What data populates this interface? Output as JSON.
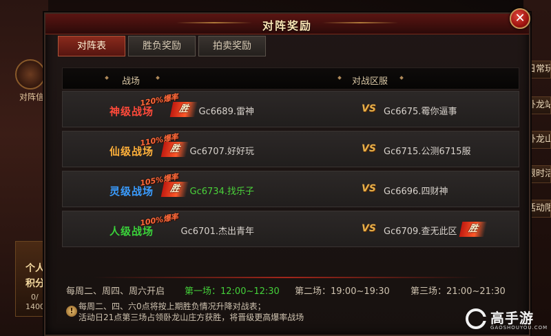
{
  "background": {
    "left_label": "对阵信",
    "personal_1": "个人",
    "personal_2": "积分",
    "personal_3": "0/",
    "personal_4": "1400",
    "right_tabs": [
      "日常玩",
      "卧龙站",
      "卧龙山",
      "限时活",
      "活动限"
    ]
  },
  "dialog": {
    "title": "对阵奖励",
    "close_symbol": "✕"
  },
  "tabs": [
    "对阵表",
    "胜负奖励",
    "拍卖奖励"
  ],
  "table": {
    "headers": {
      "battlefield": "战场",
      "servers": "对战区服"
    },
    "vs_label": "VS",
    "win_label": "胜",
    "rows": [
      {
        "level": "神级战场",
        "rate": "120%爆率",
        "level_color": "#ff4a3a",
        "team_a": "Gc6689.雷神",
        "team_a_color": "#d8d2cc",
        "team_b": "Gc6675.霉你逼事",
        "winner": "a"
      },
      {
        "level": "仙级战场",
        "rate": "110%爆率",
        "level_color": "#ffb03a",
        "team_a": "Gc6707.好好玩",
        "team_a_color": "#d8d2cc",
        "team_b": "Gc6715.公测6715服",
        "winner": "a"
      },
      {
        "level": "灵级战场",
        "rate": "105%爆率",
        "level_color": "#3a9cff",
        "team_a": "Gc6734.找乐子",
        "team_a_color": "#4ad13a",
        "team_b": "Gc6696.四财神",
        "winner": "a"
      },
      {
        "level": "人级战场",
        "rate": "100%爆率",
        "level_color": "#3ad13a",
        "team_a": "Gc6701.杰出青年",
        "team_a_color": "#d8d2cc",
        "team_b": "Gc6709.查无此区",
        "winner": "b"
      }
    ]
  },
  "schedule": {
    "days": "每周二、周四、周六开启",
    "round1": "第一场：12:00~12:30",
    "round2": "第二场：19:00~19:30",
    "round3": "第三场：21:00~21:30"
  },
  "notice": {
    "icon": "!",
    "line1": "每周二、四、六0点将按上期胜负情况升降对战表；",
    "line2": "活动日21点第三场占领卧龙山庄方获胜，将晋级更高爆率战场"
  },
  "watermark": {
    "text": "高手游",
    "sub": "GAOSHOUYOU.COM"
  }
}
